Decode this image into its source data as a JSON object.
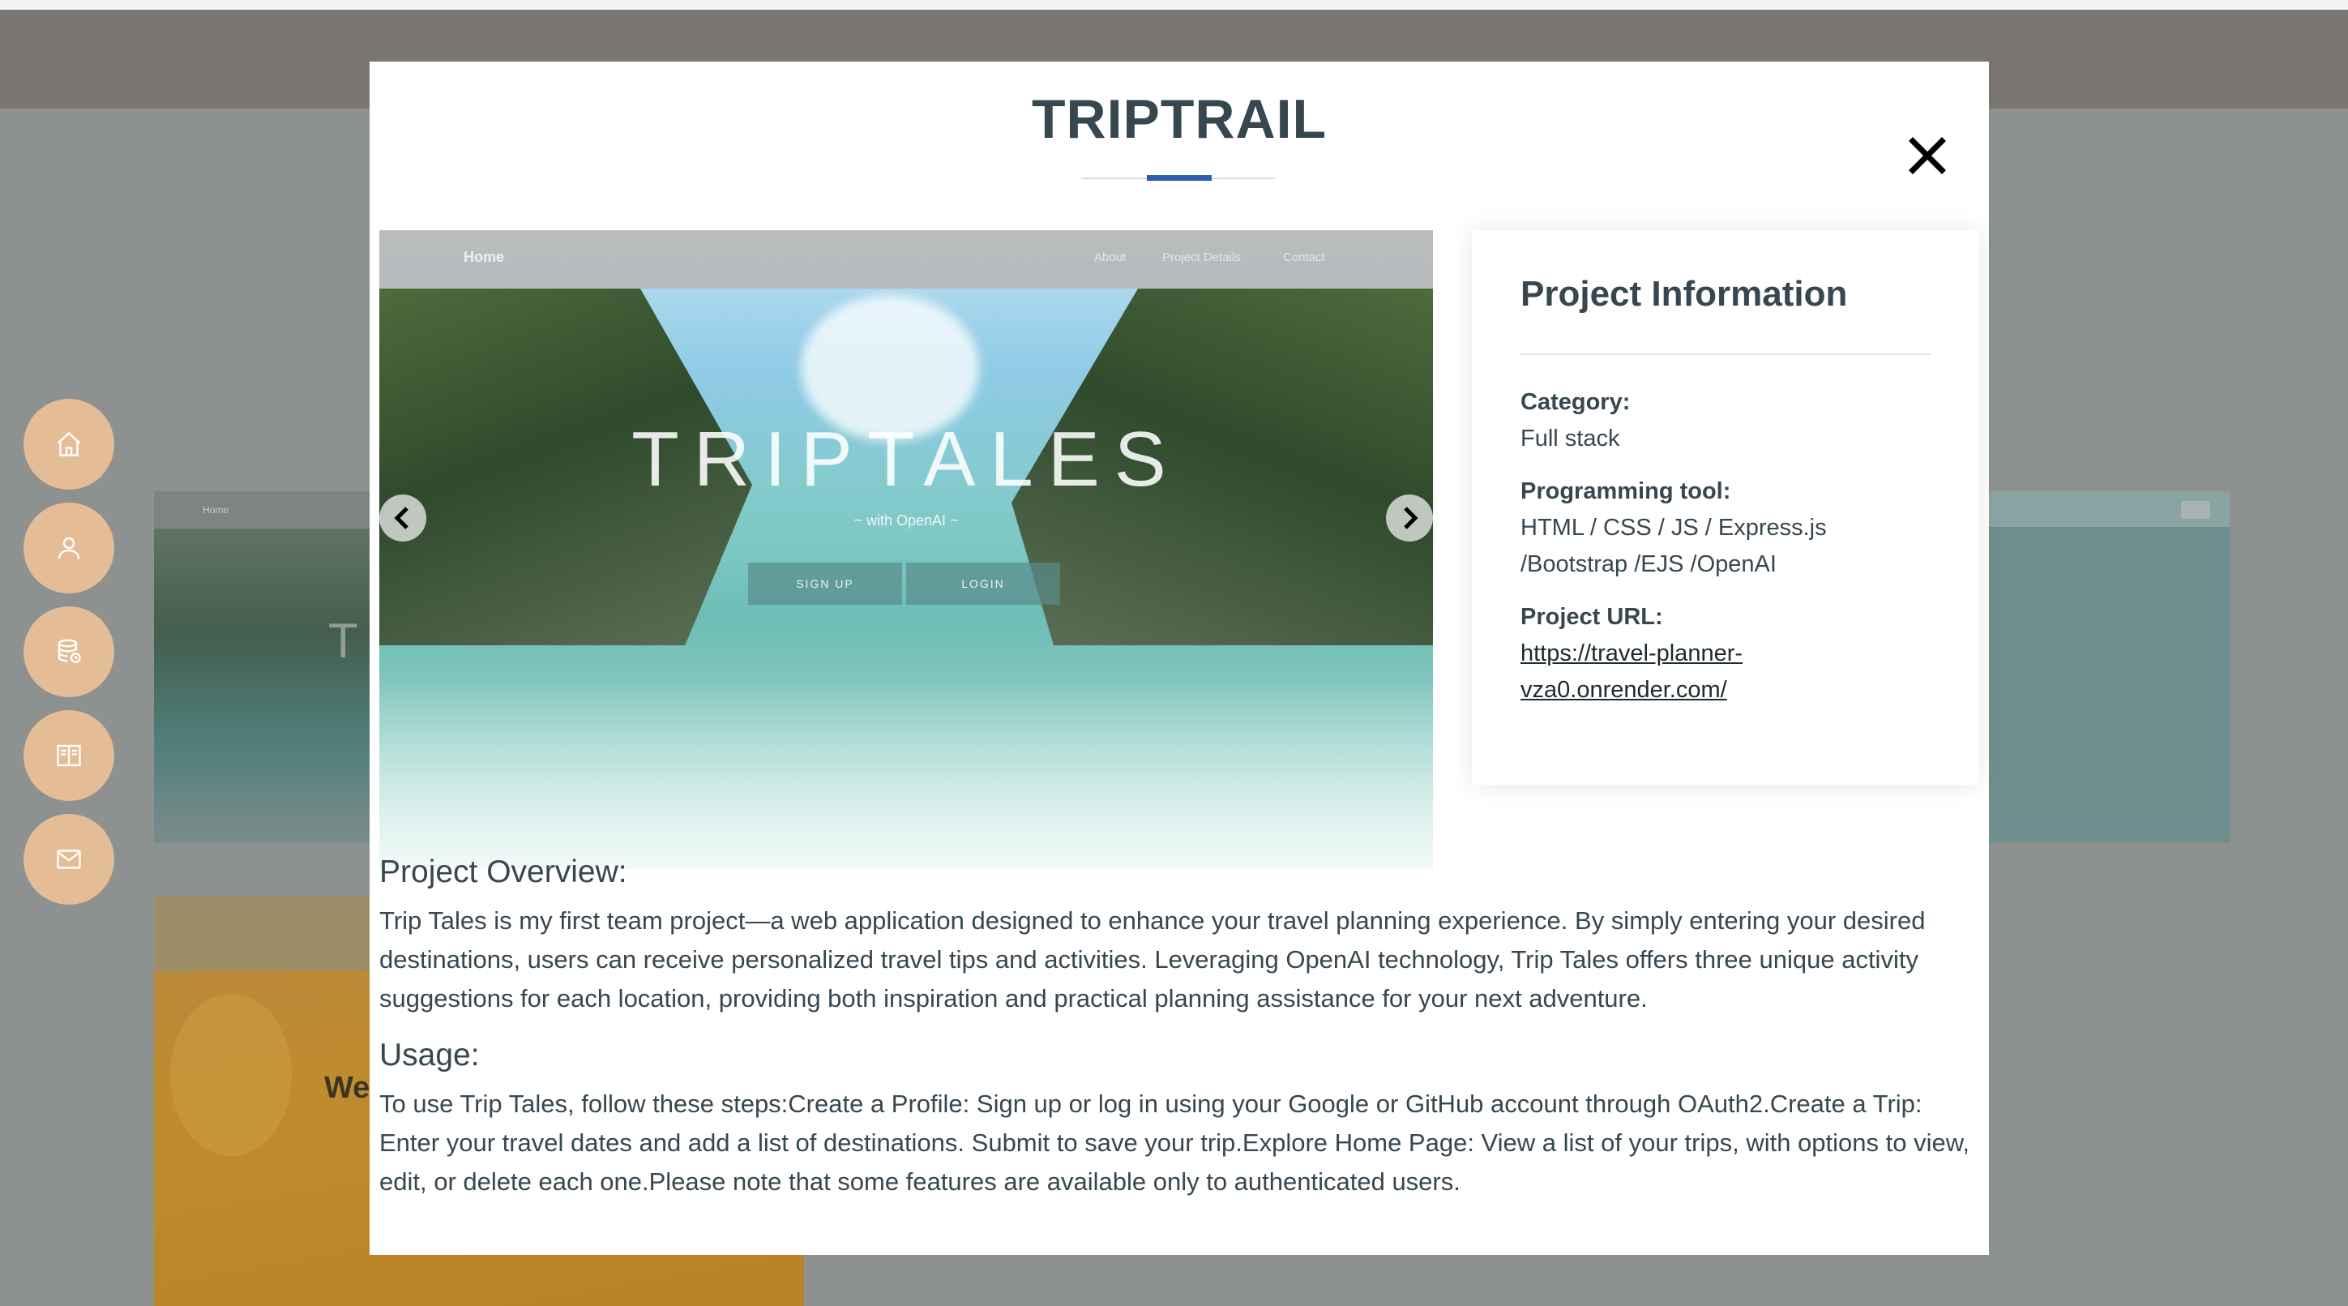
{
  "background": {
    "card_left_letters": "T",
    "card_left_home": "Home",
    "card_bottom_text": "We"
  },
  "sidenav": {
    "items": [
      {
        "icon": "home-icon"
      },
      {
        "icon": "user-icon"
      },
      {
        "icon": "database-icon"
      },
      {
        "icon": "book-icon"
      },
      {
        "icon": "mail-icon"
      }
    ]
  },
  "modal": {
    "title": "TRIPTRAIL",
    "close_icon": "close-icon",
    "slider": {
      "nav_home": "Home",
      "nav_links": [
        "About",
        "Project Details",
        "Contact"
      ],
      "hero_title": "TRIPTALES",
      "hero_subtitle": "~ with OpenAI ~",
      "signup_label": "SIGN UP",
      "login_label": "LOGIN",
      "prev_icon": "chevron-left-icon",
      "next_icon": "chevron-right-icon"
    },
    "info": {
      "title": "Project Information",
      "category_label": "Category:",
      "category_value": "Full stack",
      "tool_label": "Programming tool:",
      "tool_value": "HTML / CSS / JS / Express.js /Bootstrap /EJS /OpenAI",
      "url_label": "Project URL:",
      "url_value": "https://travel-planner-vza0.onrender.com/"
    },
    "overview_heading": "Project Overview:",
    "overview_text": "Trip Tales is my first team project—a web application designed to enhance your travel planning experience. By simply entering your desired destinations, users can receive personalized travel tips and activities. Leveraging OpenAI technology, Trip Tales offers three unique activity suggestions for each location, providing both inspiration and practical planning assistance for your next adventure.",
    "usage_heading": "Usage:",
    "usage_text": "To use Trip Tales, follow these steps:Create a Profile: Sign up or log in using your Google or GitHub account through OAuth2.Create a Trip: Enter your travel dates and add a list of destinations. Submit to save your trip.Explore Home Page: View a list of your trips, with options to view, edit, or delete each one.Please note that some features are available only to authenticated users."
  }
}
